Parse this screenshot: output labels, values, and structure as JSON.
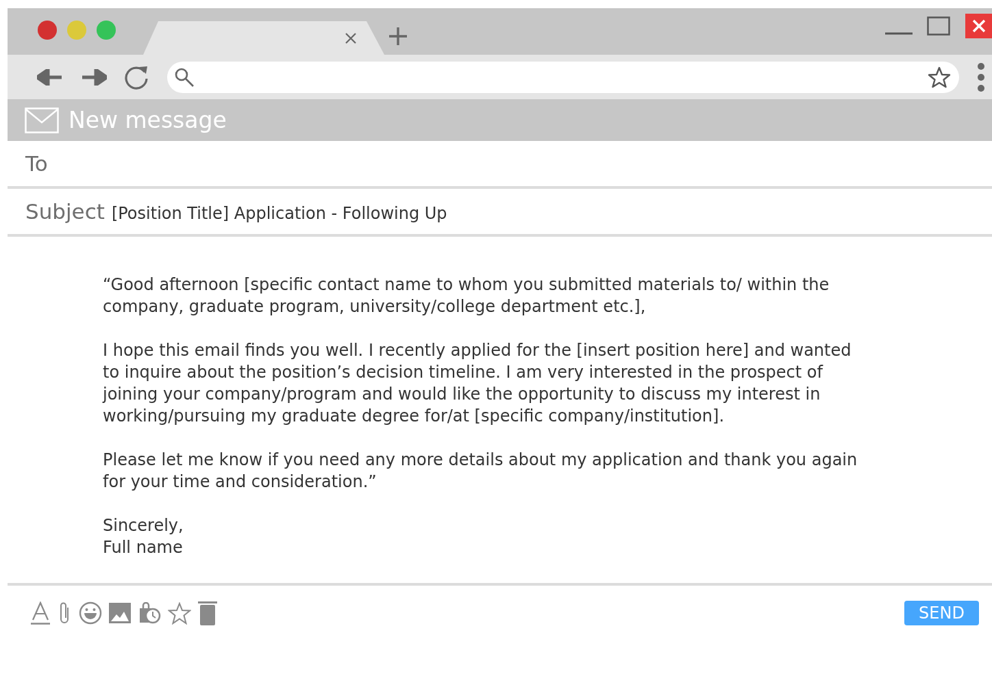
{
  "header": {
    "title": "New message"
  },
  "to": {
    "label": "To"
  },
  "subject": {
    "label": "Subject",
    "value": "[Position Title] Application - Following Up"
  },
  "body": {
    "paragraphs": [
      "“Good afternoon [specific contact name to whom you submitted materials to/ within the company, graduate program, university/college department etc.],",
      "I hope this email finds you well. I recently applied for the [insert position here] and wanted to inquire about the position’s decision timeline. I am very interested in the prospect of joining your company/program and would like the opportunity to discuss my interest in working/pursuing my graduate degree for/at [specific company/institution].",
      "Please let me know if you need any more details about my application and thank you again for your time and consideration.”"
    ],
    "signature": [
      "Sincerely,",
      "Full name"
    ]
  },
  "footer": {
    "send_button": "SEND"
  }
}
